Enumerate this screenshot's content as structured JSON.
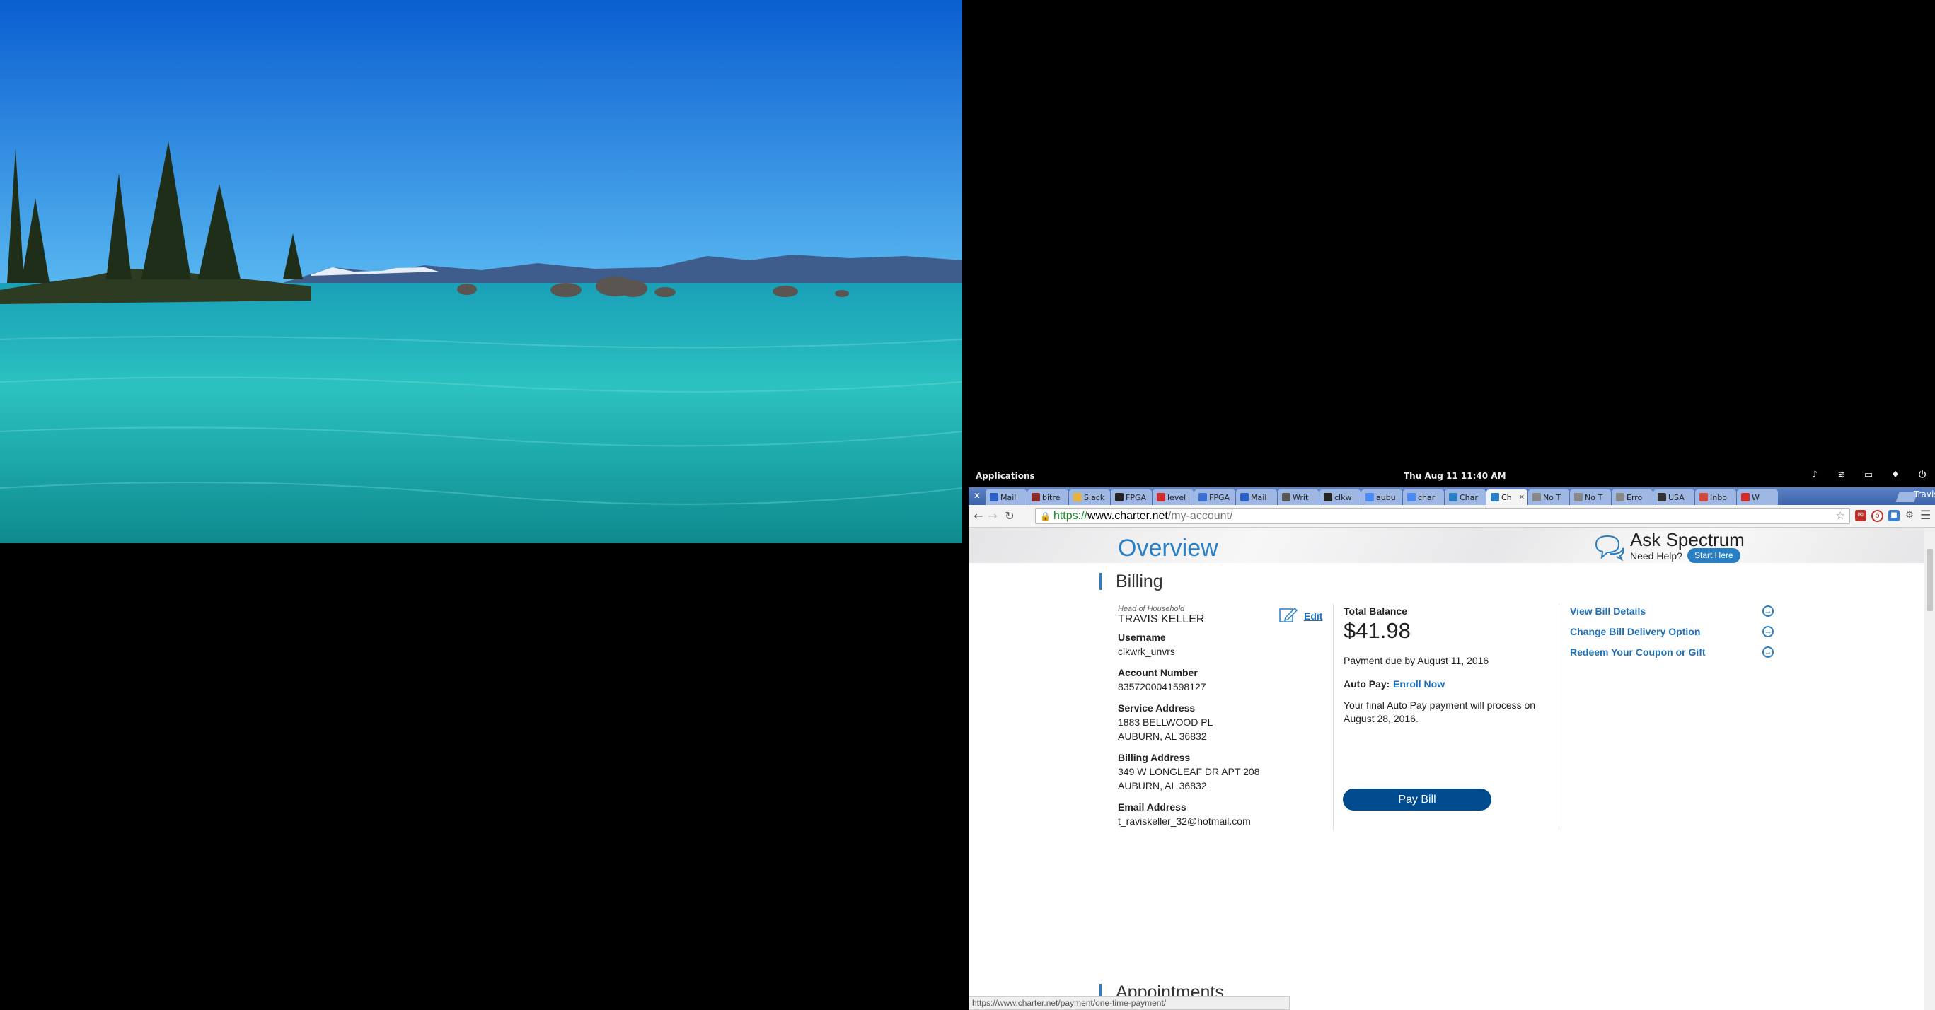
{
  "topbar": {
    "applications": "Applications",
    "clock": "Thu Aug 11   11:40 AM",
    "tray": [
      "volume-icon",
      "wifi-icon",
      "battery-icon",
      "notification-icon",
      "power-icon"
    ]
  },
  "browser": {
    "tabs": [
      {
        "title": "Mail",
        "color": "#2a60c8"
      },
      {
        "title": "bitre",
        "color": "#8a2a2a"
      },
      {
        "title": "Slack",
        "color": "#e8b23a"
      },
      {
        "title": "FPGA",
        "color": "#222222"
      },
      {
        "title": "level",
        "color": "#d32a2a"
      },
      {
        "title": "FPGA",
        "color": "#3b6fd4"
      },
      {
        "title": "Mail",
        "color": "#2a60c8"
      },
      {
        "title": "Writ",
        "color": "#555555"
      },
      {
        "title": "clkw",
        "color": "#222222"
      },
      {
        "title": "aubu",
        "color": "#4a8af4"
      },
      {
        "title": "char",
        "color": "#4a8af4"
      },
      {
        "title": "Char",
        "color": "#2a7fc4"
      },
      {
        "title": "Ch",
        "color": "#2a7fc4",
        "active": true
      },
      {
        "title": "No T",
        "color": "#888888"
      },
      {
        "title": "No T",
        "color": "#888888"
      },
      {
        "title": "Erro",
        "color": "#888888"
      },
      {
        "title": "USA",
        "color": "#333333"
      },
      {
        "title": "Inbo",
        "color": "#d44638"
      },
      {
        "title": "W",
        "color": "#d32a2a"
      }
    ],
    "user": "Travis",
    "url": {
      "scheme": "https://",
      "host": "www.charter.net",
      "path": "/my-account/"
    }
  },
  "page": {
    "title": "Overview",
    "ask": {
      "title": "Ask Spectrum",
      "need_help": "Need Help?",
      "start": "Start Here"
    },
    "billing": {
      "heading": "Billing",
      "head_label": "Head of Household",
      "name": "TRAVIS KELLER",
      "edit": "Edit",
      "username_label": "Username",
      "username": "clkwrk_unvrs",
      "account_label": "Account Number",
      "account": "8357200041598127",
      "service_label": "Service Address",
      "service_line1": "1883 BELLWOOD PL",
      "service_line2": "AUBURN, AL 36832",
      "billing_label": "Billing Address",
      "billing_line1": "349 W LONGLEAF DR APT 208",
      "billing_line2": "AUBURN, AL 36832",
      "email_label": "Email Address",
      "email": "t_raviskeller_32@hotmail.com",
      "total_label": "Total Balance",
      "total": "$41.98",
      "due": "Payment due by August 11, 2016",
      "autopay_label": "Auto Pay:",
      "autopay_link": "Enroll Now",
      "autopay_note_1": "Your final Auto Pay payment will process on",
      "autopay_note_2": "August 28, 2016.",
      "pay_bill": "Pay Bill",
      "links": [
        "View Bill Details",
        "Change Bill Delivery Option",
        "Redeem Your Coupon or Gift"
      ]
    },
    "appointments": "Appointments"
  },
  "status_url": "https://www.charter.net/payment/one-time-payment/"
}
